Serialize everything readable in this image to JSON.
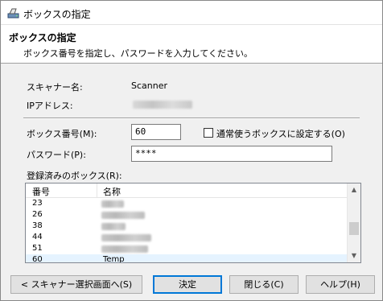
{
  "window": {
    "title": "ボックスの指定"
  },
  "header": {
    "title": "ボックスの指定",
    "subtitle": "ボックス番号を指定し、パスワードを入力してください。"
  },
  "info": {
    "scanner_label": "スキャナー名:",
    "scanner_value": "Scanner",
    "ip_label": "IPアドレス:"
  },
  "form": {
    "box_number_label": "ボックス番号(M):",
    "box_number_value": "60",
    "default_box_checkbox_label": "通常使うボックスに設定する(O)",
    "default_box_checked": false,
    "password_label": "パスワード(P):",
    "password_value": "****",
    "registered_label": "登録済みのボックス(R):"
  },
  "list": {
    "columns": [
      "番号",
      "名称"
    ],
    "rows": [
      {
        "number": "23",
        "name": ""
      },
      {
        "number": "26",
        "name": ""
      },
      {
        "number": "38",
        "name": ""
      },
      {
        "number": "44",
        "name": ""
      },
      {
        "number": "51",
        "name": ""
      },
      {
        "number": "60",
        "name": "Temp",
        "selected": true
      }
    ]
  },
  "buttons": {
    "back": "< スキャナー選択画面へ(S)",
    "ok": "決定",
    "close": "閉じる(C)",
    "help": "ヘルプ(H)"
  },
  "icons": {
    "app": "scanner-app-icon",
    "scroll_up": "scroll-up-icon",
    "scroll_down": "scroll-down-icon"
  }
}
